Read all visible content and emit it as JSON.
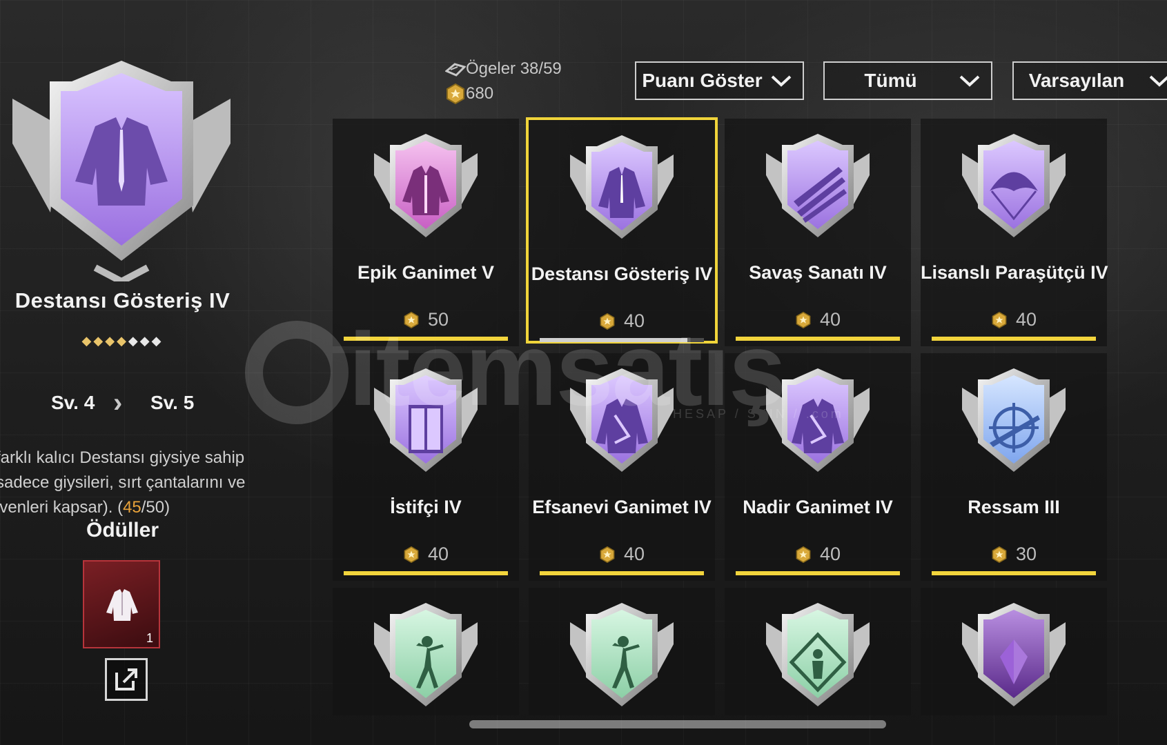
{
  "stats": {
    "items_label": "Ögeler 38/59",
    "points": "680"
  },
  "dropdowns": [
    {
      "label": "Puanı Göster"
    },
    {
      "label": "Tümü"
    },
    {
      "label": "Varsayılan"
    }
  ],
  "selected": {
    "title": "Destansı Gösteriş IV",
    "stars_filled": 4,
    "stars_total": 7,
    "level_from": "Sv. 4",
    "level_to": "Sv. 5",
    "desc_line1": "farklı kalıcı Destansı giysiye sahip",
    "desc_line2": "sadece giysileri, sırt çantalarını ve",
    "desc_line3_start": "ivenleri kapsar). (",
    "progress_current": "45",
    "progress_rest": "/50)",
    "rewards_title": "Ödüller",
    "reward_count": "1"
  },
  "cards": [
    {
      "name": "Epik Ganimet V",
      "points": "50",
      "progress": 1.0,
      "icon": "jacket-icon",
      "color": "pink"
    },
    {
      "name": "Destansı Gösteriş IV",
      "points": "40",
      "progress": 0.9,
      "icon": "suit-jacket-icon",
      "color": "purple",
      "selected": true
    },
    {
      "name": "Savaş Sanatı IV",
      "points": "40",
      "progress": 1.0,
      "icon": "rifles-icon",
      "color": "purple"
    },
    {
      "name": "Lisanslı Paraşütçü IV",
      "points": "40",
      "progress": 1.0,
      "icon": "parachute-icon",
      "color": "purple"
    },
    {
      "name": "İstifçi IV",
      "points": "40",
      "progress": 1.0,
      "icon": "locker-icon",
      "color": "purple"
    },
    {
      "name": "Efsanevi Ganimet IV",
      "points": "40",
      "progress": 1.0,
      "icon": "coat-icon",
      "color": "purple"
    },
    {
      "name": "Nadir Ganimet IV",
      "points": "40",
      "progress": 1.0,
      "icon": "coat-icon",
      "color": "purple"
    },
    {
      "name": "Ressam III",
      "points": "30",
      "progress": 1.0,
      "icon": "crosshair-rifle-icon",
      "color": "blue"
    },
    {
      "name": "",
      "icon": "dancer-icon",
      "color": "green"
    },
    {
      "name": "",
      "icon": "dancer-icon",
      "color": "green"
    },
    {
      "name": "",
      "icon": "figure-frame-icon",
      "color": "green"
    },
    {
      "name": "",
      "icon": "crystal-icon",
      "color": "darkpurple"
    }
  ],
  "watermark": {
    "brand": "itemsatış",
    "tagline": "HESAP / SKIN / .com"
  },
  "colors": {
    "accent_yellow": "#f2d43c",
    "highlight_orange": "#e8a23a",
    "badge_purple": "#b58cf0",
    "badge_pink": "#e07ad8",
    "badge_blue": "#8fb4f5",
    "badge_green": "#9ee0b8"
  }
}
